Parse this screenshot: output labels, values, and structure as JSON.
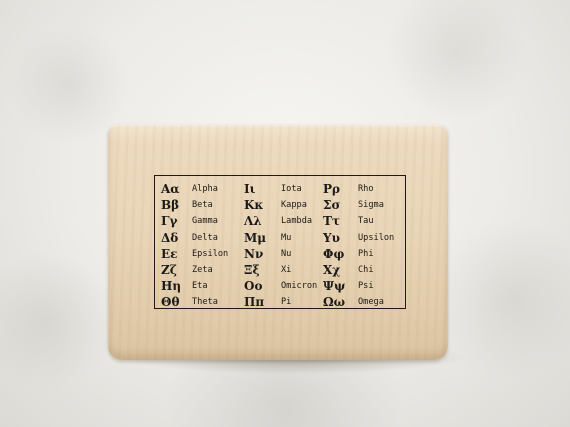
{
  "stamp": {
    "columns": [
      [
        {
          "glyph": "Αα",
          "name": "Alpha"
        },
        {
          "glyph": "Ββ",
          "name": "Beta"
        },
        {
          "glyph": "Γγ",
          "name": "Gamma"
        },
        {
          "glyph": "Δδ",
          "name": "Delta"
        },
        {
          "glyph": "Εε",
          "name": "Epsilon"
        },
        {
          "glyph": "Ζζ",
          "name": "Zeta"
        },
        {
          "glyph": "Ηη",
          "name": "Eta"
        },
        {
          "glyph": "Θθ",
          "name": "Theta"
        }
      ],
      [
        {
          "glyph": "Ιι",
          "name": "Iota"
        },
        {
          "glyph": "Κκ",
          "name": "Kappa"
        },
        {
          "glyph": "Λλ",
          "name": "Lambda"
        },
        {
          "glyph": "Μμ",
          "name": "Mu"
        },
        {
          "glyph": "Νν",
          "name": "Nu"
        },
        {
          "glyph": "Ξξ",
          "name": "Xi"
        },
        {
          "glyph": "Οο",
          "name": "Omicron"
        },
        {
          "glyph": "Ππ",
          "name": "Pi"
        }
      ],
      [
        {
          "glyph": "Ρρ",
          "name": "Rho"
        },
        {
          "glyph": "Σσ",
          "name": "Sigma"
        },
        {
          "glyph": "Ττ",
          "name": "Tau"
        },
        {
          "glyph": "Υυ",
          "name": "Upsilon"
        },
        {
          "glyph": "Φφ",
          "name": "Phi"
        },
        {
          "glyph": "Χχ",
          "name": "Chi"
        },
        {
          "glyph": "Ψψ",
          "name": "Psi"
        },
        {
          "glyph": "Ωω",
          "name": "Omega"
        }
      ]
    ]
  },
  "colors": {
    "ink": "#1c1a18",
    "wood": "#e8d4b6",
    "background": "#ecebe7"
  }
}
